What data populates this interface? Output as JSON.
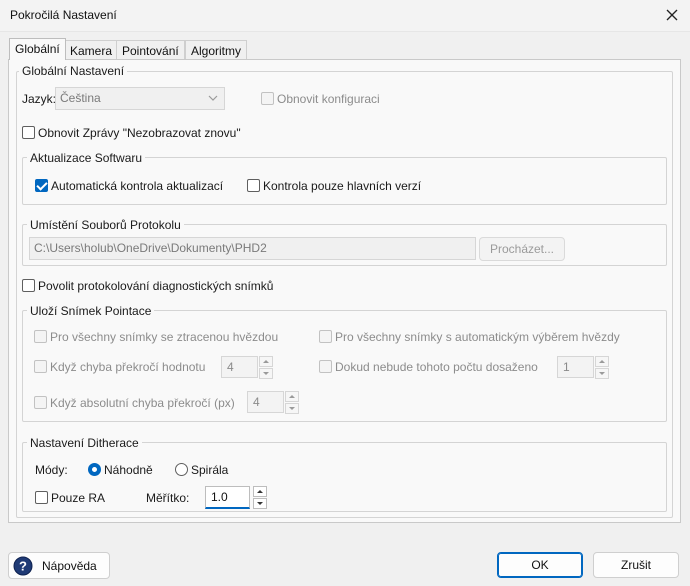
{
  "window": {
    "title": "Pokročilá Nastavení"
  },
  "tabs": [
    {
      "label": "Globální"
    },
    {
      "label": "Kamera"
    },
    {
      "label": "Pointování"
    },
    {
      "label": "Algoritmy"
    }
  ],
  "global": {
    "group_label": "Globální Nastavení",
    "language_label": "Jazyk:",
    "language_value": "Čeština",
    "reset_config_label": "Obnovit konfiguraci",
    "reset_messages_label": "Obnovit Zprávy \"Nezobrazovat znovu\"",
    "update": {
      "group_label": "Aktualizace Softwaru",
      "auto_check_label": "Automatická kontrola aktualizací",
      "major_only_label": "Kontrola pouze hlavních verzí"
    },
    "log": {
      "group_label": "Umístění Souborů Protokolu",
      "path_value": "C:\\Users\\holub\\OneDrive\\Dokumenty\\PHD2",
      "browse_label": "Procházet..."
    },
    "diag_label": "Povolit protokolování diagnostických snímků",
    "save": {
      "group_label": "Uloží Snímek Pointace",
      "lost_star_label": "Pro všechny snímky se ztracenou hvězdou",
      "auto_select_label": "Pro všechny snímky s automatickým výběrem hvězdy",
      "error_exceeds_label": "Když chyba překročí hodnotu",
      "error_exceeds_value": "4",
      "until_count_label": "Dokud nebude tohoto počtu dosaženo",
      "until_count_value": "1",
      "abs_error_label": "Když absolutní chyba překročí (px)",
      "abs_error_value": "4"
    },
    "dither": {
      "group_label": "Nastavení Ditherace",
      "modes_label": "Módy:",
      "random_label": "Náhodně",
      "spiral_label": "Spirála",
      "ra_only_label": "Pouze RA",
      "scale_label": "Měřítko:",
      "scale_value": "1.0"
    }
  },
  "footer": {
    "help_label": "Nápověda",
    "ok_label": "OK",
    "cancel_label": "Zrušit"
  },
  "colors": {
    "accent": "#0067c0"
  }
}
